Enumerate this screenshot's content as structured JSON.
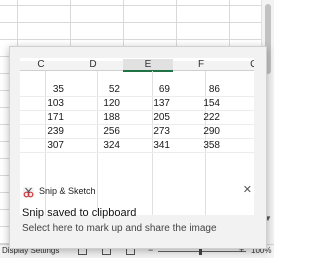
{
  "statusbar": {
    "display_settings": "Display Settings",
    "zoom_minus": "−",
    "zoom_plus": "+",
    "zoom_level": "100%"
  },
  "toast": {
    "app_name": "Snip & Sketch",
    "title": "Snip saved to clipboard",
    "body": "Select here to mark up and share the image",
    "close_glyph": "✕"
  },
  "preview": {
    "columns": [
      "C",
      "D",
      "E",
      "F",
      "G"
    ],
    "active_column": "E",
    "rows": [
      [
        "35",
        "52",
        "69",
        "86"
      ],
      [
        "103",
        "120",
        "137",
        "154"
      ],
      [
        "171",
        "188",
        "205",
        "222"
      ],
      [
        "239",
        "256",
        "273",
        "290"
      ],
      [
        "307",
        "324",
        "341",
        "358"
      ]
    ]
  },
  "colors": {
    "accent": "#217346",
    "toast_bg": "#f2f2f2"
  },
  "icons": [
    "snip-sketch-icon",
    "close-icon",
    "zoom-minus-icon",
    "zoom-plus-icon"
  ]
}
